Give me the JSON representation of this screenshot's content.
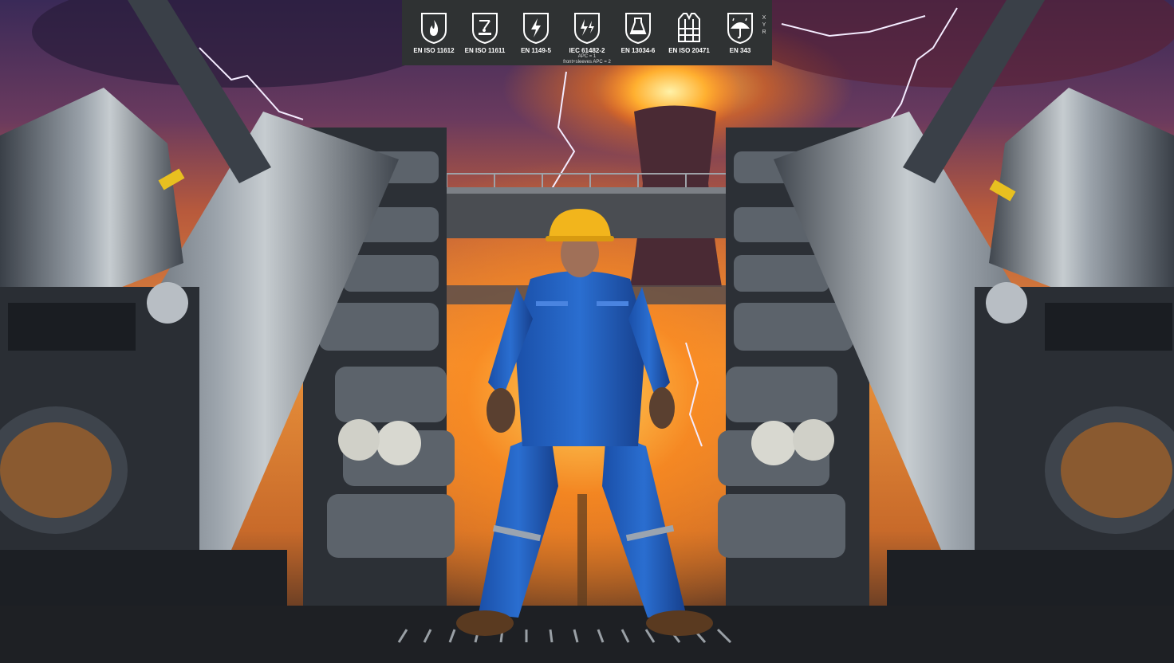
{
  "certifications": [
    {
      "icon": "flame-shield-icon",
      "standard": "EN ISO 11612"
    },
    {
      "icon": "welding-shield-icon",
      "standard": "EN ISO 11611"
    },
    {
      "icon": "lightning-shield-icon",
      "standard": "EN 1149-5"
    },
    {
      "icon": "arc-flash-shield-icon",
      "standard": "IEC 61482-2",
      "notes": [
        "APC = 1",
        "front+sleeves APC = 2"
      ]
    },
    {
      "icon": "chemical-shield-icon",
      "standard": "EN 13034-6"
    },
    {
      "icon": "hi-vis-vest-icon",
      "standard": "EN ISO 20471"
    },
    {
      "icon": "rain-umbrella-shield-icon",
      "standard": "EN 343",
      "side_labels": [
        "X",
        "Y",
        "R"
      ]
    }
  ],
  "colors": {
    "badge_background": "#2f3233",
    "coverall_blue": "#1f5fc0",
    "hard_hat_yellow": "#f2b51c"
  }
}
